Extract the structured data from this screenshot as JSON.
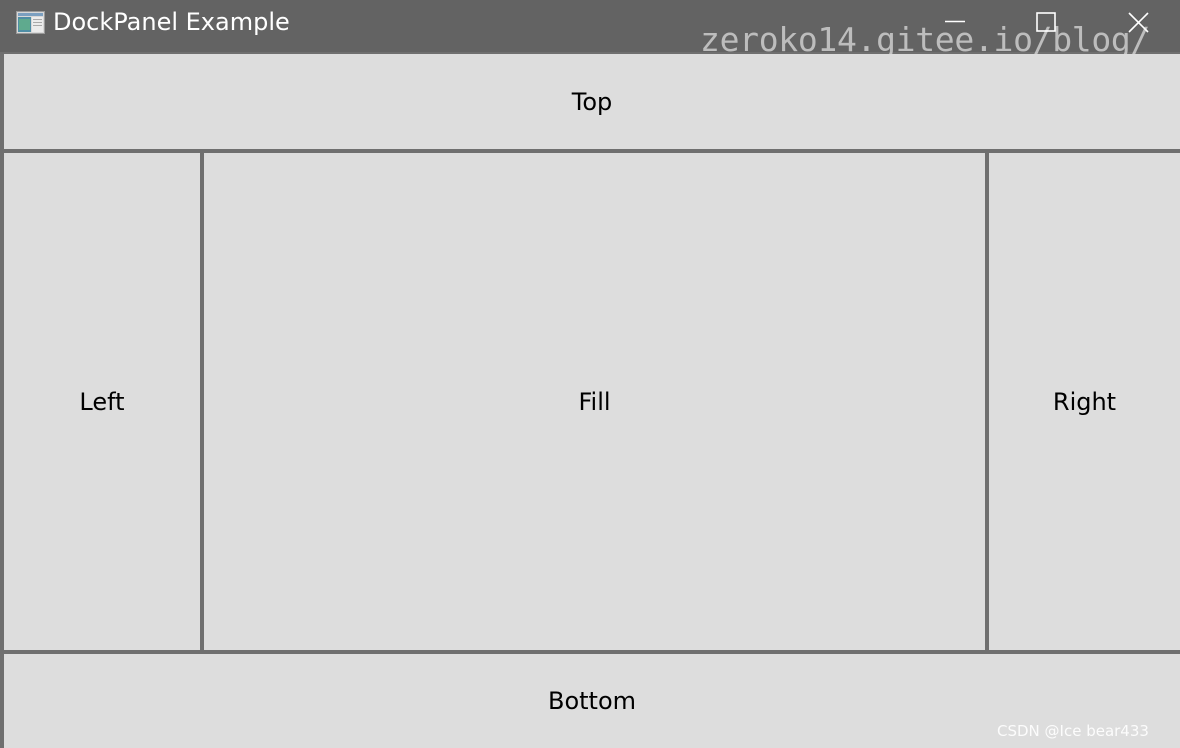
{
  "window": {
    "title": "DockPanel Example",
    "icon": "application-icon",
    "watermark": "zeroko14.gitee.io/blog/",
    "controls": {
      "minimize_icon": "minimize-icon",
      "maximize_icon": "maximize-icon",
      "close_icon": "close-icon"
    }
  },
  "panels": {
    "top": "Top",
    "left": "Left",
    "fill": "Fill",
    "right": "Right",
    "bottom": "Bottom"
  },
  "footer_watermark": "CSDN @Ice  bear433",
  "colors": {
    "titlebar": "#636363",
    "panel_background": "#dddddd",
    "divider": "#6f6f6f",
    "panel_text": "#000000"
  }
}
